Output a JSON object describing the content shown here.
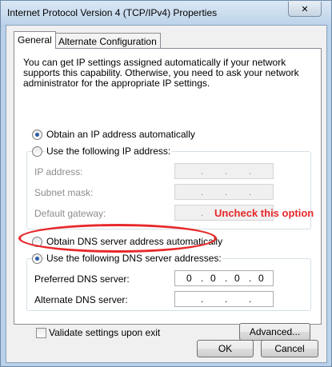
{
  "window": {
    "title": "Internet Protocol Version 4 (TCP/IPv4) Properties",
    "close_symbol": "✕"
  },
  "tabs": [
    {
      "label": "General",
      "active": true
    },
    {
      "label": "Alternate Configuration",
      "active": false
    }
  ],
  "general": {
    "description": "You can get IP settings assigned automatically if your network supports this capability. Otherwise, you need to ask your network administrator for the appropriate IP settings.",
    "ip": {
      "auto_label": "Obtain an IP address automatically",
      "manual_label": "Use the following IP address:",
      "auto_selected": true,
      "fields": [
        {
          "label": "IP address:",
          "value": ". . ."
        },
        {
          "label": "Subnet mask:",
          "value": ". . ."
        },
        {
          "label": "Default gateway:",
          "value": ". . ."
        }
      ]
    },
    "dns": {
      "auto_label": "Obtain DNS server address automatically",
      "manual_label": "Use the following DNS server addresses:",
      "manual_selected": true,
      "preferred_label": "Preferred DNS server:",
      "preferred_octets": [
        "0",
        "0",
        "0",
        "0"
      ],
      "alternate_label": "Alternate DNS server:"
    },
    "validate_label": "Validate settings upon exit",
    "validate_checked": false,
    "advanced_label": "Advanced..."
  },
  "annotation": {
    "text": "Uncheck this option",
    "color": "#e8282b"
  },
  "footer": {
    "ok_label": "OK",
    "cancel_label": "Cancel"
  }
}
